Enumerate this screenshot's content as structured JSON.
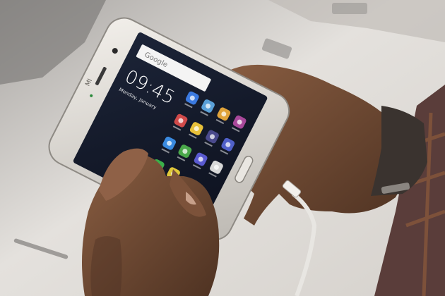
{
  "photo": {
    "subject": "hands holding a charging smartphone",
    "colors": {
      "background": "#cfcbc6",
      "table": "#e6e3df",
      "phone_frame": "#d9d6d2",
      "screen": "#141a2a",
      "skin": "#7a5238",
      "skin_shadow": "#4a3024",
      "watch_strap": "#3a332f",
      "sleeve": "#5a3d3a"
    }
  },
  "phone": {
    "brand": "MI",
    "search_label": "Google",
    "clock": "09:45",
    "date": "Monday, January"
  },
  "app_icons": [
    {
      "name": "settings-icon",
      "color": "#3b7ae0"
    },
    {
      "name": "camera-icon",
      "color": "#5aa0d8"
    },
    {
      "name": "mail-icon",
      "color": "#e0a33a"
    },
    {
      "name": "photos-icon",
      "color": "#a8489a"
    },
    {
      "name": "music-icon",
      "color": "#d04a4a"
    },
    {
      "name": "gallery-icon",
      "color": "#e8c13a"
    },
    {
      "name": "apps-grid-icon",
      "color": "#4a4a8c"
    },
    {
      "name": "browser-icon",
      "color": "#5060c8"
    },
    {
      "name": "theme-icon",
      "color": "#3a8ae0"
    },
    {
      "name": "tools-icon",
      "color": "#4aa84a"
    },
    {
      "name": "security-icon",
      "color": "#5a5ad0"
    },
    {
      "name": "calendar-icon",
      "color": "#d8d8d8"
    },
    {
      "name": "phone-icon",
      "color": "#3ab04a"
    },
    {
      "name": "messages-icon",
      "color": "#e0c83a"
    }
  ]
}
